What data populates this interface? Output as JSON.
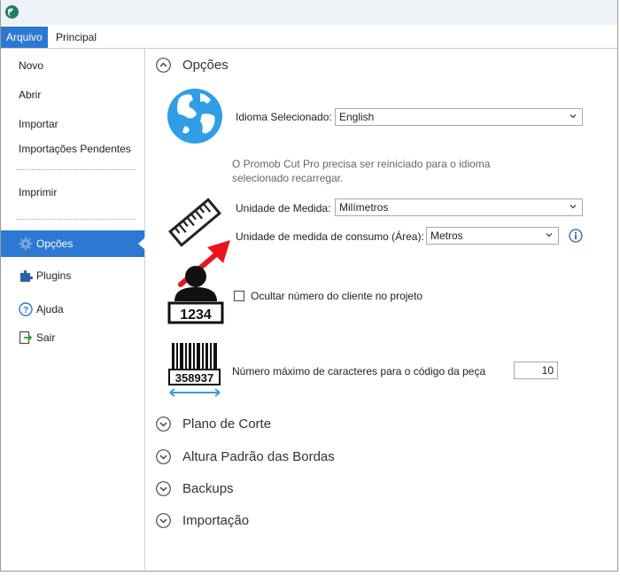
{
  "ribbon": {
    "tabs": [
      "Arquivo",
      "Principal"
    ]
  },
  "sidebar": {
    "items": {
      "novo": "Novo",
      "abrir": "Abrir",
      "importar": "Importar",
      "importacoes_pendentes": "Importações Pendentes",
      "imprimir": "Imprimir",
      "opcoes": "Opções",
      "plugins": "Plugins",
      "ajuda": "Ajuda",
      "sair": "Sair"
    }
  },
  "main": {
    "options": {
      "title": "Opções",
      "language_label": "Idioma Selecionado:",
      "language_value": "English",
      "restart_note": "O Promob Cut Pro precisa ser reiniciado para o idioma selecionado recarregar.",
      "unit_label": "Unidade de Medida:",
      "unit_value": "Milímetros",
      "area_unit_label": "Unidade de medida de consumo (Área):",
      "area_unit_value": "Metros",
      "hide_client_label": "Ocultar número do cliente no projeto",
      "hide_client_checked": false,
      "client_number_icon_text": "1234",
      "barcode_icon_text": "358937",
      "max_chars_label": "Número máximo de caracteres para o código da peça",
      "max_chars_value": "10"
    },
    "sections": [
      "Plano de Corte",
      "Altura Padrão das Bordas",
      "Backups",
      "Importação"
    ]
  },
  "colors": {
    "accent": "#2b79d3",
    "globe": "#2f9ee6",
    "arrow": "#e8151b"
  }
}
